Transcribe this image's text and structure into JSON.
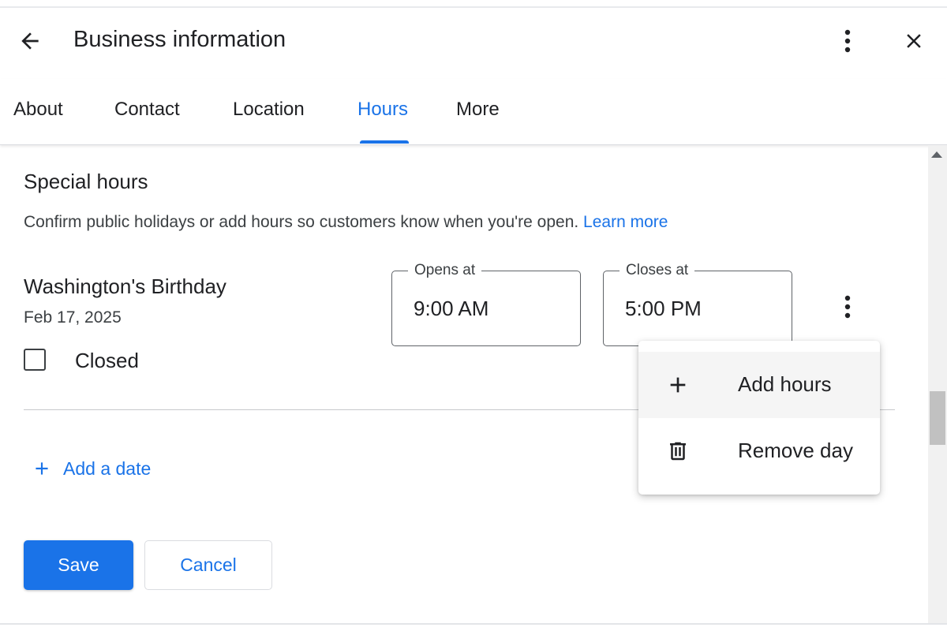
{
  "header": {
    "title": "Business information",
    "back_icon": "arrow-back-icon",
    "more_icon": "more-vert-icon",
    "close_icon": "close-icon"
  },
  "tabs": [
    {
      "label": "About",
      "active": false
    },
    {
      "label": "Contact",
      "active": false
    },
    {
      "label": "Location",
      "active": false
    },
    {
      "label": "Hours",
      "active": true
    },
    {
      "label": "More",
      "active": false
    }
  ],
  "special_hours": {
    "title": "Special hours",
    "description": "Confirm public holidays or add hours so customers know when you're open.",
    "learn_more": "Learn more"
  },
  "day": {
    "name": "Washington's Birthday",
    "date": "Feb 17, 2025",
    "closed_label": "Closed",
    "closed_checked": false,
    "opens_label": "Opens at",
    "opens_value": "9:00 AM",
    "closes_label": "Closes at",
    "closes_value": "5:00 PM"
  },
  "add_date": {
    "label": "Add a date",
    "icon": "plus-icon"
  },
  "actions": {
    "save": "Save",
    "cancel": "Cancel"
  },
  "menu": {
    "items": [
      {
        "label": "Add hours",
        "icon": "plus-icon"
      },
      {
        "label": "Remove day",
        "icon": "trash-icon"
      }
    ]
  },
  "colors": {
    "accent": "#1a73e8",
    "text": "#202124",
    "secondary_text": "#3c4043",
    "border": "#5f6368"
  }
}
